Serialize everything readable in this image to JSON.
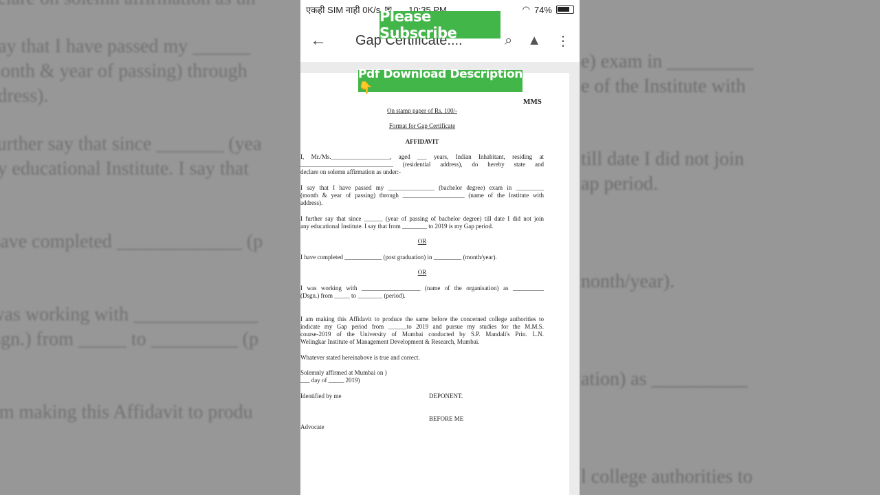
{
  "background": {
    "lines": [
      "declare on solemn affirmation as un",
      "I say that I have passed my ______",
      "(month & year of passing) through",
      "address).",
      "I further say that since _______ (yea",
      "any educational Institute.   I say that",
      "I have completed _____________ (p",
      "I was working with _____________",
      "Dsgn.) from _____ to _________ (p",
      "I am making this Affidavit to produ"
    ],
    "right_lines": [
      "e) exam in _________",
      "e of the Institute with",
      "till date I did not join",
      "ap period.",
      "nonth/year).",
      "ation) as __________",
      "l college authorities to"
    ]
  },
  "status_bar": {
    "carrier": "एकही SIM नाही 0K/s",
    "time": "10:35 PM",
    "battery": "74%"
  },
  "toolbar": {
    "title": "Gap Certificate....",
    "back_icon": "arrow-left",
    "search_icon": "search",
    "drive_icon": "drive-add",
    "menu_icon": "more-vert"
  },
  "overlays": {
    "subscribe": "Please Subscribe",
    "pdf_download": "Pdf Download Description 👇"
  },
  "document": {
    "code": "MMS",
    "stamp": "On stamp paper of Rs. 100/-",
    "format": "Format for Gap Certificate",
    "heading": "AFFIDAVIT",
    "p1a": "I, Mr./Ms.___________________,  aged  ___  years,  Indian  Inhabitant,  residing  at",
    "p1b": "______________________________  (residential address),  do hereby state and",
    "p1c": "declare on solemn affirmation as under:-",
    "p2a": "I say that I have passed my _______________ (bachelor degree) exam in _________",
    "p2b": "(month & year of passing) through ____________________ (name of the Institute with",
    "p2c": "address).",
    "p3a": "I further say that since ______ (year of passing of bachelor degree) till date I did not join",
    "p3b": "any educational Institute.   I say that from ________ to 2019 is my Gap period.",
    "or1": "OR",
    "p4": "I have completed ____________ (post graduation) in _________ (month/year).",
    "or2": "OR",
    "p5a": "I was working with ___________________ (name of the organisation) as __________",
    "p5b": "(Dsgn.) from _____ to ________ (period).",
    "p6a": "I am making this Affidavit to produce the same before the concerned college authorities to",
    "p6b": "indicate my Gap period from ______to    2019 and pursue my studies for the M.M.S.",
    "p6c": "course-2019  of  the  University  of  Mumbai  conducted  by  S.P.  Mandali's  Prin.  L.N.",
    "p6d": "Welingkar Institute of Management Development & Research, Mumbai.",
    "p7": "Whatever stated hereinabove is true and correct.",
    "p8a": "Solemnly affirmed at Mumbai on )",
    "p8b": "___ day of _____  2019)",
    "identified": "Identified by me",
    "deponent": "DEPONENT.",
    "before": "BEFORE ME",
    "advocate": "Advocate"
  }
}
